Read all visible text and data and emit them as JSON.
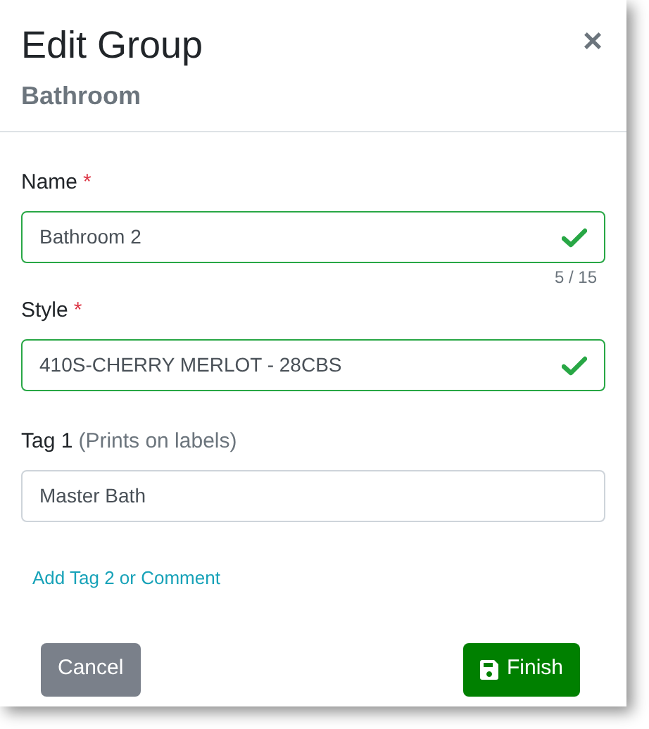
{
  "dialog": {
    "title": "Edit Group",
    "subtitle": "Bathroom",
    "close": "×"
  },
  "fields": [
    {
      "label": "Name",
      "required_mark": "*",
      "value": "Bathroom 2",
      "valid": true,
      "counter": "5 / 15"
    },
    {
      "label": "Style",
      "required_mark": "*",
      "value": "410S-CHERRY MERLOT - 28CBS",
      "valid": true
    },
    {
      "label": "Tag 1",
      "hint": "(Prints on labels)",
      "value": "Master Bath",
      "valid": false
    }
  ],
  "link": "Add Tag 2 or Comment",
  "buttons": {
    "cancel": "Cancel",
    "finish": "Finish"
  }
}
